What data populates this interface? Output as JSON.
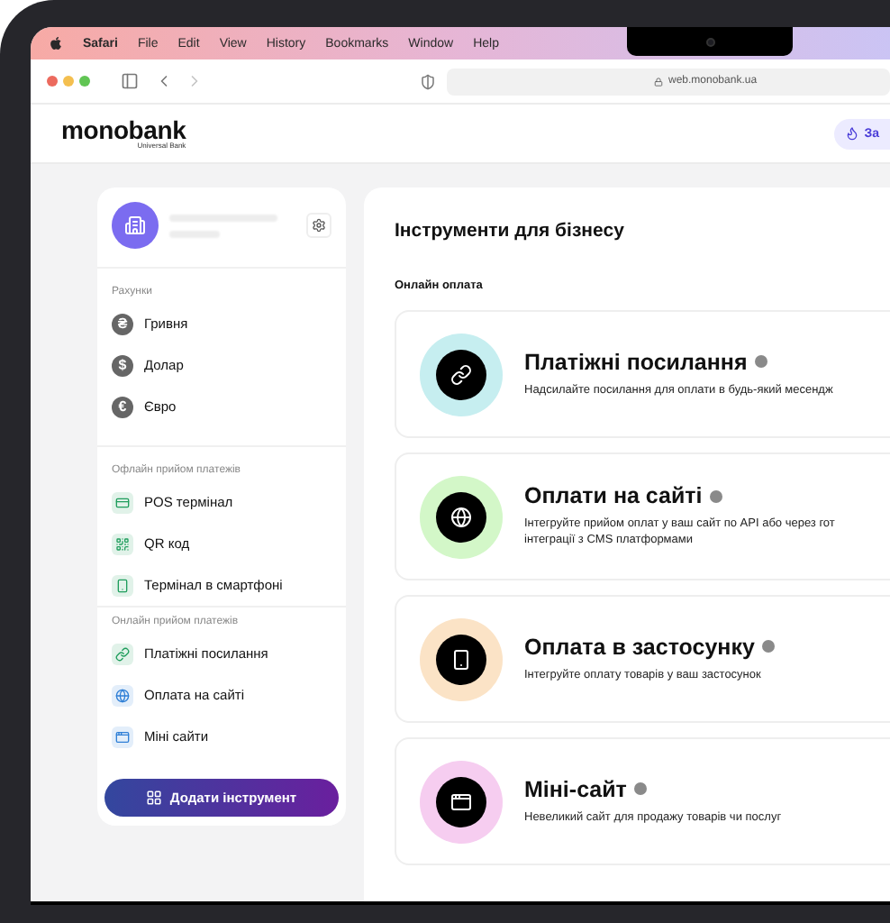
{
  "menu_bar": {
    "app": "Safari",
    "items": [
      "File",
      "Edit",
      "View",
      "History",
      "Bookmarks",
      "Window",
      "Help"
    ]
  },
  "browser": {
    "url": "web.monobank.ua",
    "back_disabled": false,
    "forward_disabled": true
  },
  "header": {
    "logo": "monobank",
    "logo_sub": "Universal Bank",
    "action": "За"
  },
  "sidebar": {
    "sections": [
      {
        "title": "Рахунки",
        "items": [
          {
            "kind": "account",
            "symbol": "₴",
            "label": "Гривня"
          },
          {
            "kind": "account",
            "symbol": "$",
            "label": "Долар"
          },
          {
            "kind": "account",
            "symbol": "€",
            "label": "Євро"
          }
        ]
      },
      {
        "title": "Офлайн прийом платежів",
        "items": [
          {
            "kind": "pos",
            "label": "POS термінал",
            "color": "#1f9d5c"
          },
          {
            "kind": "qr",
            "label": "QR код",
            "color": "#1f9d5c"
          },
          {
            "kind": "phone",
            "label": "Термінал в смартфоні",
            "color": "#1f9d5c"
          }
        ]
      },
      {
        "title": "Онлайн прийом платежів",
        "items": [
          {
            "kind": "link",
            "label": "Платіжні посилання",
            "color": "#1f9d5c"
          },
          {
            "kind": "globe",
            "label": "Оплата на сайті",
            "color": "#2f7fd6"
          },
          {
            "kind": "site",
            "label": "Міні сайти",
            "color": "#2f7fd6"
          }
        ]
      }
    ],
    "add_button": "Додати інструмент"
  },
  "main": {
    "title": "Інструменти для бізнесу",
    "section": "Онлайн оплата",
    "cards": [
      {
        "kind": "link",
        "title": "Платіжні посилання",
        "color": "#c6eef0",
        "description": [
          "Надсилайте посилання для оплати в будь-який месендж"
        ]
      },
      {
        "kind": "globe",
        "title": "Оплати на сайті",
        "color": "#d3f7c8",
        "description": [
          "Інтегруйте прийом оплат у ваш сайт по API або через гот",
          "інтеграції з CMS платформами"
        ]
      },
      {
        "kind": "phone",
        "title": "Оплата в застосунку",
        "color": "#fbe3c6",
        "description": [
          "Інтегруйте оплату товарів у ваш застосунок"
        ]
      },
      {
        "kind": "site",
        "title": "Міні-сайт",
        "color": "#f6cdf0",
        "description": [
          "Невеликий сайт для продажу товарів чи послуг"
        ]
      }
    ]
  }
}
